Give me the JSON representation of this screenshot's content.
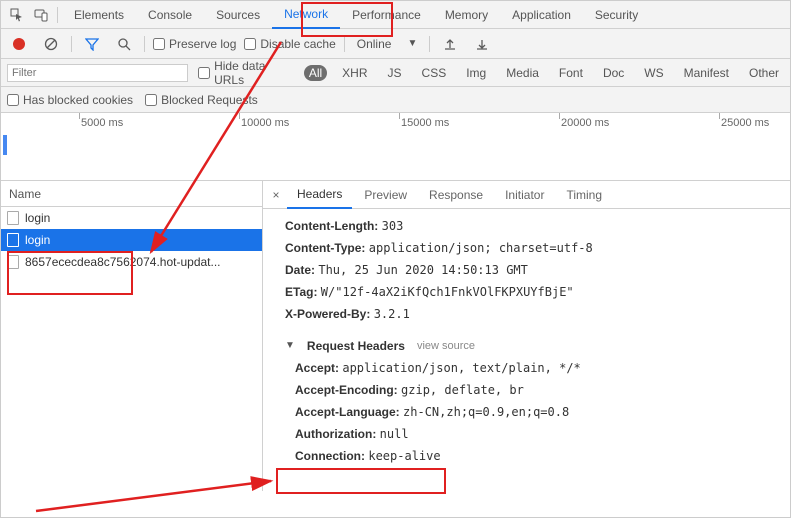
{
  "topTabs": {
    "elements": "Elements",
    "console": "Console",
    "sources": "Sources",
    "network": "Network",
    "performance": "Performance",
    "memory": "Memory",
    "application": "Application",
    "security": "Security"
  },
  "controls": {
    "preserveLog": "Preserve log",
    "disableCache": "Disable cache",
    "throttling": "Online"
  },
  "filterBar": {
    "placeholder": "Filter",
    "hideDataUrls": "Hide data URLs",
    "types": {
      "all": "All",
      "xhr": "XHR",
      "js": "JS",
      "css": "CSS",
      "img": "Img",
      "media": "Media",
      "font": "Font",
      "doc": "Doc",
      "ws": "WS",
      "manifest": "Manifest",
      "other": "Other"
    }
  },
  "row4": {
    "hasBlockedCookies": "Has blocked cookies",
    "blockedRequests": "Blocked Requests"
  },
  "timeline": {
    "ticks": [
      "5000 ms",
      "10000 ms",
      "15000 ms",
      "20000 ms",
      "25000 ms"
    ]
  },
  "requests": {
    "nameHeader": "Name",
    "items": [
      {
        "name": "login",
        "selected": false
      },
      {
        "name": "login",
        "selected": true
      },
      {
        "name": "8657ececdea8c7562074.hot-updat...",
        "selected": false
      }
    ]
  },
  "detailTabs": {
    "headers": "Headers",
    "preview": "Preview",
    "response": "Response",
    "initiator": "Initiator",
    "timing": "Timing"
  },
  "responseHeaders": [
    {
      "k": "Content-Length",
      "v": "303"
    },
    {
      "k": "Content-Type",
      "v": "application/json; charset=utf-8"
    },
    {
      "k": "Date",
      "v": "Thu, 25 Jun 2020 14:50:13 GMT"
    },
    {
      "k": "ETag",
      "v": "W/\"12f-4aX2iKfQch1FnkVOlFKPXUYfBjE\""
    },
    {
      "k": "X-Powered-By",
      "v": "3.2.1"
    }
  ],
  "requestHeadersSection": {
    "title": "Request Headers",
    "aux": "view source"
  },
  "requestHeaders": [
    {
      "k": "Accept",
      "v": "application/json, text/plain, */*"
    },
    {
      "k": "Accept-Encoding",
      "v": "gzip, deflate, br"
    },
    {
      "k": "Accept-Language",
      "v": "zh-CN,zh;q=0.9,en;q=0.8"
    },
    {
      "k": "Authorization",
      "v": "null"
    },
    {
      "k": "Connection",
      "v": "keep-alive"
    }
  ]
}
